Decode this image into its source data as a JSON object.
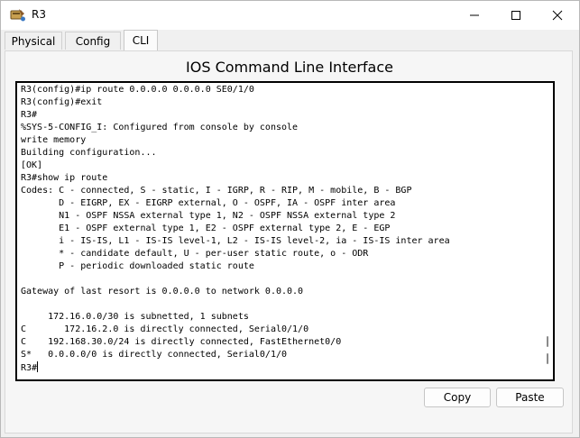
{
  "window": {
    "title": "R3"
  },
  "tabs": [
    {
      "label": "Physical"
    },
    {
      "label": "Config"
    },
    {
      "label": "CLI"
    }
  ],
  "active_tab": "CLI",
  "panel": {
    "title": "IOS Command Line Interface"
  },
  "terminal": {
    "lines": [
      "R3(config)#ip route 0.0.0.0 0.0.0.0 SE0/1/0",
      "R3(config)#exit",
      "R3#",
      "%SYS-5-CONFIG_I: Configured from console by console",
      "write memory",
      "Building configuration...",
      "[OK]",
      "R3#show ip route",
      "Codes: C - connected, S - static, I - IGRP, R - RIP, M - mobile, B - BGP",
      "       D - EIGRP, EX - EIGRP external, O - OSPF, IA - OSPF inter area",
      "       N1 - OSPF NSSA external type 1, N2 - OSPF NSSA external type 2",
      "       E1 - OSPF external type 1, E2 - OSPF external type 2, E - EGP",
      "       i - IS-IS, L1 - IS-IS level-1, L2 - IS-IS level-2, ia - IS-IS inter area",
      "       * - candidate default, U - per-user static route, o - ODR",
      "       P - periodic downloaded static route",
      "",
      "Gateway of last resort is 0.0.0.0 to network 0.0.0.0",
      "",
      "     172.16.0.0/30 is subnetted, 1 subnets",
      "C       172.16.2.0 is directly connected, Serial0/1/0",
      "C    192.168.30.0/24 is directly connected, FastEthernet0/0",
      "S*   0.0.0.0/0 is directly connected, Serial0/1/0",
      "R3#"
    ]
  },
  "buttons": {
    "copy": "Copy",
    "paste": "Paste"
  }
}
